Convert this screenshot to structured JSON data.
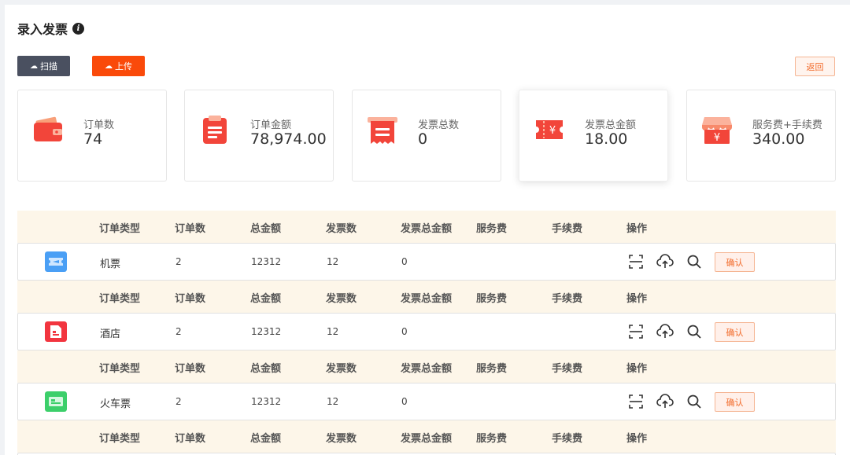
{
  "page": {
    "title": "录入发票",
    "info_icon": "info-icon"
  },
  "toolbar": {
    "scan_label": "扫描",
    "upload_label": "上传",
    "back_label": "返回"
  },
  "stats": [
    {
      "label": "订单数",
      "value": "74",
      "icon": "wallet-icon"
    },
    {
      "label": "订单金额",
      "value": "78,974.00",
      "icon": "clipboard-icon"
    },
    {
      "label": "发票总数",
      "value": "0",
      "icon": "receipt-icon"
    },
    {
      "label": "发票总金额",
      "value": "18.00",
      "icon": "ticket-yen-icon"
    },
    {
      "label": "服务费+手续费",
      "value": "340.00",
      "icon": "shop-yen-icon"
    }
  ],
  "table": {
    "headers": {
      "type": "订单类型",
      "orders": "订单数",
      "total": "总金额",
      "invoices": "发票数",
      "invoice_total": "发票总金额",
      "service_fee": "服务费",
      "handling_fee": "手续费",
      "actions": "操作"
    },
    "rows": [
      {
        "type": "机票",
        "orders": "2",
        "total": "12312",
        "invoices": "12",
        "invoice_total": "0",
        "icon": "flight-ticket-icon",
        "color": "#4a9ff5",
        "confirm": "确认"
      },
      {
        "type": "酒店",
        "orders": "2",
        "total": "12312",
        "invoices": "12",
        "invoice_total": "0",
        "icon": "hotel-icon",
        "color": "#f2353f",
        "confirm": "确认"
      },
      {
        "type": "火车票",
        "orders": "2",
        "total": "12312",
        "invoices": "12",
        "invoice_total": "0",
        "icon": "train-ticket-icon",
        "color": "#3ccf6a",
        "confirm": "确认"
      }
    ]
  },
  "colors": {
    "accent": "#fa4a0a",
    "card_icon": "#f2453a",
    "header_bg": "#fdf6e9"
  }
}
